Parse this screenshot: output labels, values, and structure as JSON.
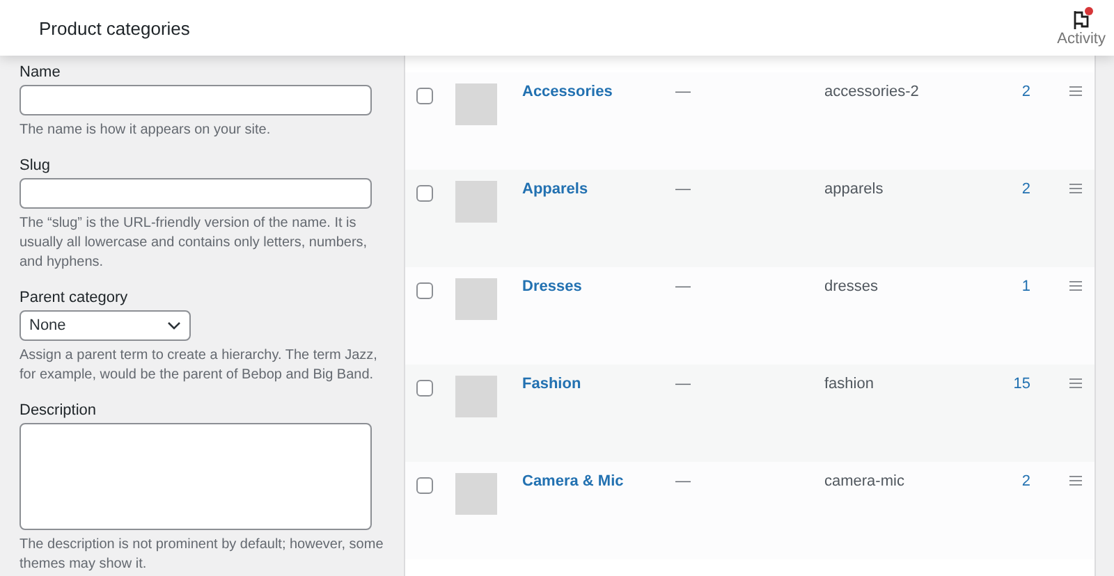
{
  "header": {
    "title": "Product categories",
    "activity": {
      "label": "Activity",
      "unread": true
    }
  },
  "form": {
    "fields": [
      {
        "kind": "text",
        "label": "Name",
        "help": "The name is how it appears on your site."
      },
      {
        "kind": "text",
        "label": "Slug",
        "help": "The “slug” is the URL-friendly version of the name. It is usually all lowercase and contains only letters, numbers, and hyphens."
      },
      {
        "kind": "select",
        "label": "Parent category",
        "value": "None",
        "help": "Assign a parent term to create a hierarchy. The term Jazz, for example, would be the parent of Bebop and Big Band."
      },
      {
        "kind": "textarea",
        "label": "Description",
        "help": "The description is not prominent by default; however, some themes may show it."
      }
    ]
  },
  "table": {
    "rows": [
      {
        "name": "Accessories",
        "description": "—",
        "slug": "accessories-2",
        "count": "2",
        "checked": false
      },
      {
        "name": "Apparels",
        "description": "—",
        "slug": "apparels",
        "count": "2",
        "checked": false
      },
      {
        "name": "Dresses",
        "description": "—",
        "slug": "dresses",
        "count": "1",
        "checked": false
      },
      {
        "name": "Fashion",
        "description": "—",
        "slug": "fashion",
        "count": "15",
        "checked": false
      },
      {
        "name": "Camera & Mic",
        "description": "—",
        "slug": "camera-mic",
        "count": "2",
        "checked": false
      }
    ]
  }
}
